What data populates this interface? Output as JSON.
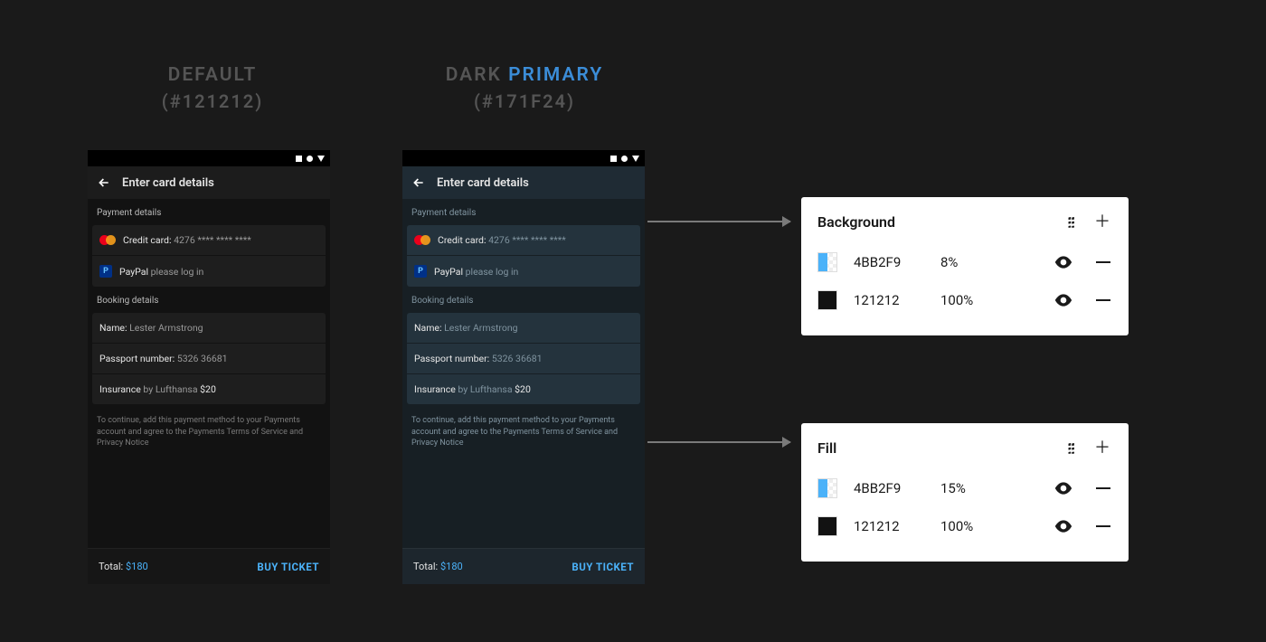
{
  "headings": {
    "default": {
      "word1": "Default",
      "hex": "(#121212)"
    },
    "primary": {
      "word1": "Dark ",
      "word2": "Primary",
      "hex": "(#171F24)"
    }
  },
  "phone": {
    "appbar_title": "Enter card details",
    "payment_section": "Payment details",
    "credit_label": "Credit card:",
    "credit_masked": "4276 **** **** ****",
    "paypal_label": "PayPal",
    "paypal_hint": "please log in",
    "booking_section": "Booking details",
    "name_label": "Name:",
    "name_value": "Lester Armstrong",
    "passport_label": "Passport number:",
    "passport_value": "5326 36681",
    "insurance_label": "Insurance",
    "insurance_by": "by Lufthansa",
    "insurance_price": "$20",
    "fineprint": "To continue, add this payment method to your Payments account and agree to the Payments Terms of Service and Privacy Notice",
    "total_label": "Total:",
    "total_value": "$180",
    "cta": "BUY TICKET"
  },
  "panels": {
    "background": {
      "title": "Background",
      "fills": [
        {
          "hex": "4BB2F9",
          "opacity": "8%",
          "swatch": "blue-checker"
        },
        {
          "hex": "121212",
          "opacity": "100%",
          "swatch": "black"
        }
      ]
    },
    "fill": {
      "title": "Fill",
      "fills": [
        {
          "hex": "4BB2F9",
          "opacity": "15%",
          "swatch": "blue-checker"
        },
        {
          "hex": "121212",
          "opacity": "100%",
          "swatch": "black"
        }
      ]
    }
  }
}
